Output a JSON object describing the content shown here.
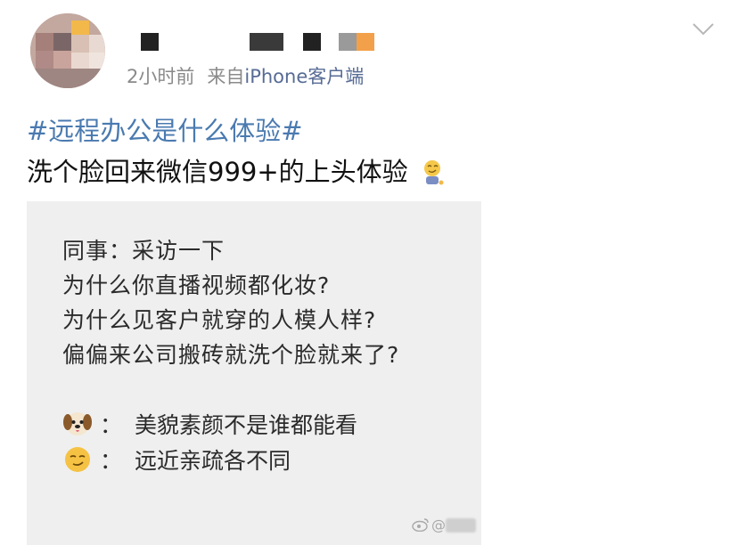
{
  "post": {
    "time": "2小时前",
    "source_prefix": "来自",
    "source": "iPhone客户端",
    "hashtag": "#远程办公是什么体验#",
    "text": "洗个脸回来微信999+的上头体验",
    "inline_emoji": "smirk-emoji"
  },
  "image": {
    "lines": [
      "同事：采访一下",
      "为什么你直播视频都化妆?",
      "为什么见客户就穿的人模人样?",
      "偏偏来公司搬砖就洗个脸就来了?"
    ],
    "replies": [
      {
        "icon": "dog-emoji",
        "colon": "：",
        "text": "美貌素颜不是谁都能看"
      },
      {
        "icon": "smirk-emoji",
        "colon": "：",
        "text": "远近亲疏各不同"
      }
    ],
    "watermark": "@"
  },
  "colors": {
    "hashtag": "#4a7ab0",
    "source": "#576b95",
    "meta": "#8a8a8a",
    "image_bg": "#efefef"
  }
}
